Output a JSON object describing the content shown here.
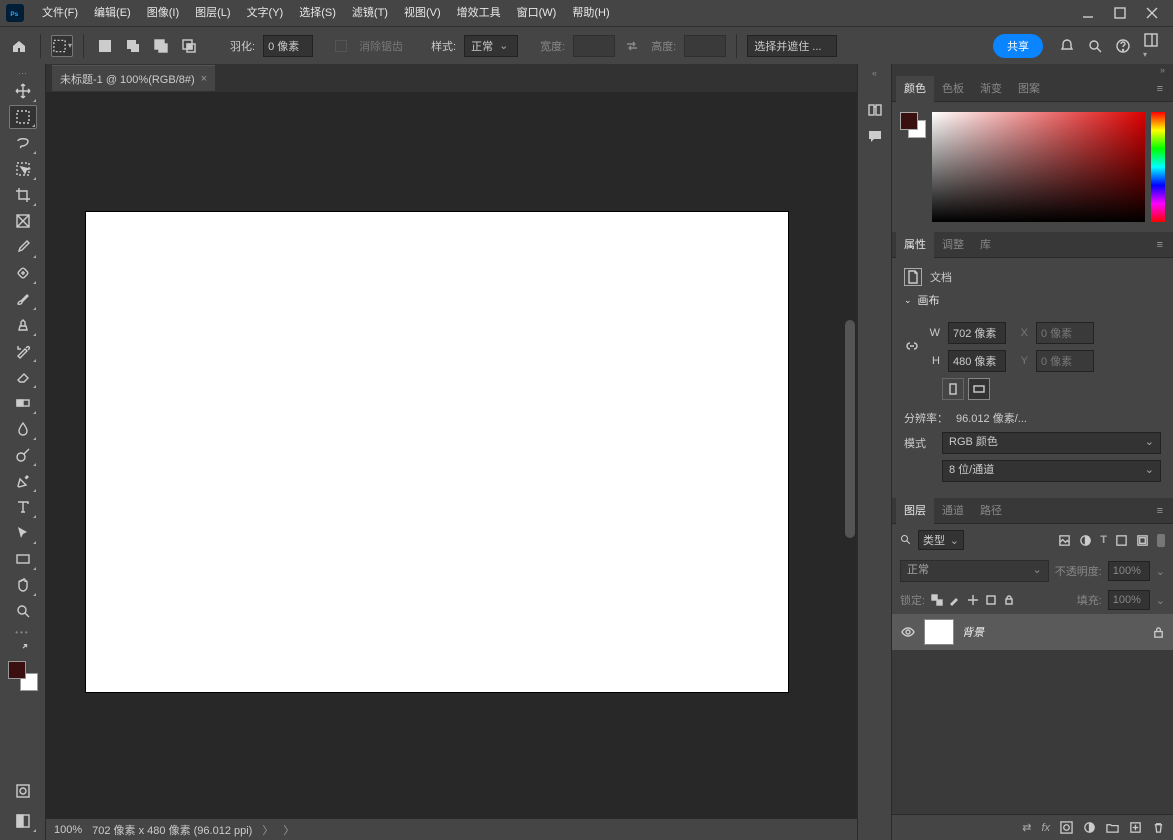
{
  "menubar": {
    "items": [
      "文件(F)",
      "编辑(E)",
      "图像(I)",
      "图层(L)",
      "文字(Y)",
      "选择(S)",
      "滤镜(T)",
      "视图(V)",
      "增效工具",
      "窗口(W)",
      "帮助(H)"
    ]
  },
  "optionsbar": {
    "feather_label": "羽化:",
    "feather_value": "0 像素",
    "antialias_label": "消除锯齿",
    "style_label": "样式:",
    "style_value": "正常",
    "width_label": "宽度:",
    "height_label": "高度:",
    "select_mask_btn": "选择并遮住 ...",
    "share_btn": "共享"
  },
  "document": {
    "tab_title": "未标题-1 @ 100%(RGB/8#)",
    "zoom": "100%",
    "status": "702 像素 x 480 像素 (96.012 ppi)"
  },
  "colors": {
    "foreground": "#3a0f0f",
    "background": "#ffffff"
  },
  "color_panel": {
    "tabs": [
      "颜色",
      "色板",
      "渐变",
      "图案"
    ]
  },
  "properties_panel": {
    "tabs": [
      "属性",
      "调整",
      "库"
    ],
    "doc_label": "文档",
    "section_canvas": "画布",
    "w_label": "W",
    "w_value": "702 像素",
    "h_label": "H",
    "h_value": "480 像素",
    "x_label": "X",
    "x_value": "0 像素",
    "y_label": "Y",
    "y_value": "0 像素",
    "resolution_label": "分辨率：",
    "resolution_value": "96.012 像素/...",
    "mode_label": "模式",
    "mode_value": "RGB 颜色",
    "depth_value": "8 位/通道"
  },
  "layers_panel": {
    "tabs": [
      "图层",
      "通道",
      "路径"
    ],
    "kind_label": "类型",
    "blend_value": "正常",
    "opacity_label": "不透明度:",
    "opacity_value": "100%",
    "lock_label": "锁定:",
    "fill_label": "填充:",
    "fill_value": "100%",
    "layers": [
      {
        "name": "背景",
        "visible": true,
        "locked": true
      }
    ]
  }
}
